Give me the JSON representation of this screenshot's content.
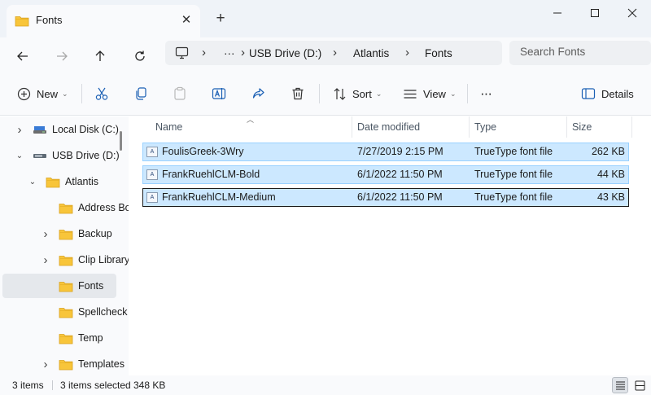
{
  "window": {
    "tab_title": "Fonts",
    "new_tab_symbol": "+",
    "close_tab_symbol": "✕"
  },
  "address": {
    "breadcrumbs": [
      "USB Drive (D:)",
      "Atlantis",
      "Fonts"
    ],
    "overflow": "···",
    "search_placeholder": "Search Fonts"
  },
  "toolbar": {
    "new_label": "New",
    "sort_label": "Sort",
    "view_label": "View",
    "more_label": "···",
    "details_label": "Details"
  },
  "nav": {
    "items": [
      {
        "label": "Local Disk (C:)",
        "icon": "drive-icon",
        "expander": "collapsed"
      },
      {
        "label": "USB Drive (D:)",
        "icon": "usb-drive-icon",
        "expander": "expanded"
      },
      {
        "label": "Atlantis",
        "icon": "folder-icon",
        "expander": "expanded"
      },
      {
        "label": "Address Bo",
        "icon": "folder-icon",
        "expander": "none"
      },
      {
        "label": "Backup",
        "icon": "folder-icon",
        "expander": "collapsed"
      },
      {
        "label": "Clip Library",
        "icon": "folder-icon",
        "expander": "collapsed"
      },
      {
        "label": "Fonts",
        "icon": "folder-icon",
        "expander": "none",
        "selected": true
      },
      {
        "label": "Spellcheck",
        "icon": "folder-icon",
        "expander": "none"
      },
      {
        "label": "Temp",
        "icon": "folder-icon",
        "expander": "none"
      },
      {
        "label": "Templates",
        "icon": "folder-icon",
        "expander": "collapsed"
      }
    ]
  },
  "files": {
    "columns": [
      "Name",
      "Date modified",
      "Type",
      "Size"
    ],
    "rows": [
      {
        "name": "FoulisGreek-3Wry",
        "date": "7/27/2019 2:15 PM",
        "type": "TrueType font file",
        "size": "262 KB"
      },
      {
        "name": "FrankRuehlCLM-Bold",
        "date": "6/1/2022 11:50 PM",
        "type": "TrueType font file",
        "size": "44 KB"
      },
      {
        "name": "FrankRuehlCLM-Medium",
        "date": "6/1/2022 11:50 PM",
        "type": "TrueType font file",
        "size": "43 KB"
      }
    ],
    "file_icon_glyph": "A"
  },
  "status": {
    "item_count": "3 items",
    "selected": "3 items selected",
    "selected_size": "348 KB"
  },
  "colors": {
    "selection_fill": "#cce8ff",
    "selection_border": "#99d1ff",
    "folder": "#f8c53a"
  }
}
